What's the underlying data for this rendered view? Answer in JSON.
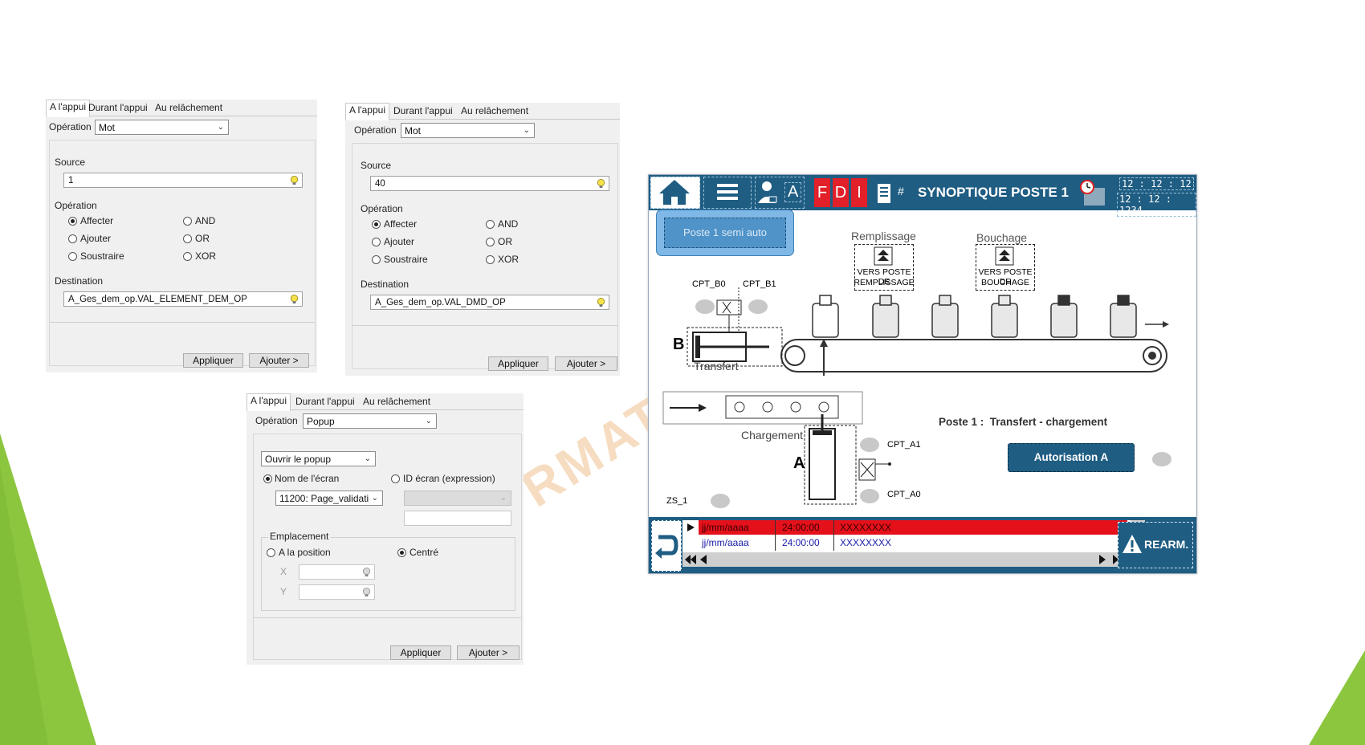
{
  "colors": {
    "accent_green": "#8cc63e",
    "hmi_blue": "#1f5d83",
    "alarm_red": "#e4111b",
    "watermark": "#f6dcc0"
  },
  "watermark": "RMATI",
  "dialog1": {
    "tabs": [
      "A l'appui",
      "Durant l'appui",
      "Au relâchement"
    ],
    "operation_label": "Opération",
    "operation_value": "Mot",
    "source_label": "Source",
    "source_value": "1",
    "op_group_label": "Opération",
    "radios": [
      "Affecter",
      "AND",
      "Ajouter",
      "OR",
      "Soustraire",
      "XOR"
    ],
    "destination_label": "Destination",
    "destination_value": "A_Ges_dem_op.VAL_ELEMENT_DEM_OP",
    "apply": "Appliquer",
    "add": "Ajouter >"
  },
  "dialog2": {
    "tabs": [
      "A l'appui",
      "Durant l'appui",
      "Au relâchement"
    ],
    "operation_label": "Opération",
    "operation_value": "Mot",
    "source_label": "Source",
    "source_value": "40",
    "op_group_label": "Opération",
    "radios": [
      "Affecter",
      "AND",
      "Ajouter",
      "OR",
      "Soustraire",
      "XOR"
    ],
    "destination_label": "Destination",
    "destination_value": "A_Ges_dem_op.VAL_DMD_OP",
    "apply": "Appliquer",
    "add": "Ajouter >"
  },
  "dialog3": {
    "tabs": [
      "A l'appui",
      "Durant l'appui",
      "Au relâchement"
    ],
    "operation_label": "Opération",
    "operation_value": "Popup",
    "action_value": "Ouvrir le popup",
    "screen_name_label": "Nom de l'écran",
    "screen_id_label": "ID écran (expression)",
    "screen_value": "11200: Page_validati",
    "placement_label": "Emplacement",
    "at_position_label": "A la position",
    "centered_label": "Centré",
    "x_label": "X",
    "y_label": "Y",
    "apply": "Appliquer",
    "add": "Ajouter >"
  },
  "hmi": {
    "letter_a": "A",
    "f": "F",
    "d": "D",
    "i": "I",
    "hash": "#",
    "title": "SYNOPTIQUE POSTE 1",
    "time_top": "12 : 12 : 12",
    "time_bottom": "12 : 12 : 1234",
    "mode_button": "Poste 1 semi auto",
    "remplissage": "Remplissage",
    "vers_remplissage_1": "VERS POSTE DE",
    "vers_remplissage_2": "REMPLISSAGE",
    "bouchage": "Bouchage",
    "vers_bouchage_1": "VERS POSTE DE",
    "vers_bouchage_2": "BOUCHAGE",
    "cpt_b0": "CPT_B0",
    "cpt_b1": "CPT_B1",
    "label_b": "B",
    "transfert": "Transfert",
    "chargement": "Chargement",
    "label_a": "A",
    "cpt_a1": "CPT_A1",
    "cpt_a0": "CPT_A0",
    "zs1": "ZS_1",
    "poste_title": "Poste 1 :  Transfert - chargement",
    "autorisation": "Autorisation A",
    "alarm_rows": [
      {
        "date": "jj/mm/aaaa",
        "time": "24:00:00",
        "text": "XXXXXXXX"
      },
      {
        "date": "jj/mm/aaaa",
        "time": "24:00:00",
        "text": "XXXXXXXX"
      }
    ],
    "rearm": "REARM."
  }
}
